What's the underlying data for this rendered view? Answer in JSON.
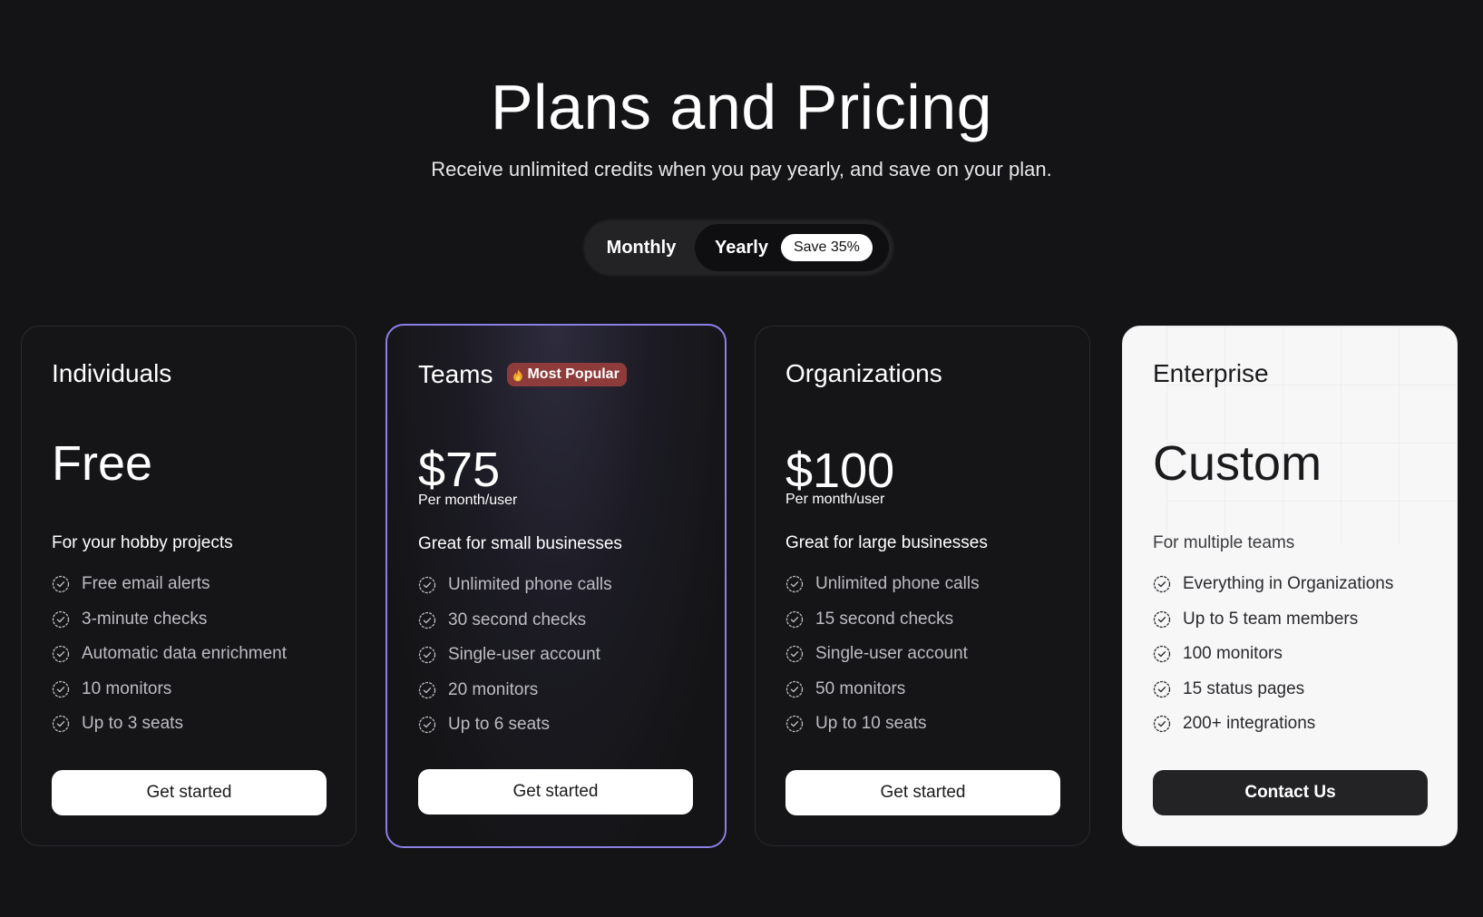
{
  "header": {
    "title": "Plans and Pricing",
    "subtitle": "Receive unlimited credits when you pay yearly, and save on your plan."
  },
  "billing": {
    "monthly_label": "Monthly",
    "yearly_label": "Yearly",
    "yearly_badge": "Save 35%",
    "selected": "Yearly"
  },
  "colors": {
    "background": "#141416",
    "popular_border": "#8b7fe6",
    "popular_badge": "#8e3b3b",
    "enterprise_card": "#f7f7f8"
  },
  "plans": [
    {
      "name": "Individuals",
      "price": "Free",
      "price_note": "",
      "tagline": "For your hobby projects",
      "features": [
        "Free email alerts",
        "3-minute checks",
        "Automatic data enrichment",
        "10 monitors",
        "Up to 3 seats"
      ],
      "cta": "Get started"
    },
    {
      "name": "Teams",
      "badge": "Most Popular",
      "badge_icon": "fire-icon",
      "price": "$75",
      "price_note": "Per month/user",
      "tagline": "Great for small businesses",
      "features": [
        "Unlimited phone calls",
        "30 second checks",
        "Single-user account",
        "20 monitors",
        "Up to 6 seats"
      ],
      "cta": "Get started"
    },
    {
      "name": "Organizations",
      "price": "$100",
      "price_note": "Per month/user",
      "tagline": "Great for large businesses",
      "features": [
        "Unlimited phone calls",
        "15 second checks",
        "Single-user account",
        "50 monitors",
        "Up to 10 seats"
      ],
      "cta": "Get started"
    },
    {
      "name": "Enterprise",
      "price": "Custom",
      "price_note": "",
      "tagline": "For multiple teams",
      "features": [
        "Everything in Organizations",
        "Up to 5 team members",
        "100 monitors",
        "15 status pages",
        "200+ integrations"
      ],
      "cta": "Contact Us"
    }
  ]
}
